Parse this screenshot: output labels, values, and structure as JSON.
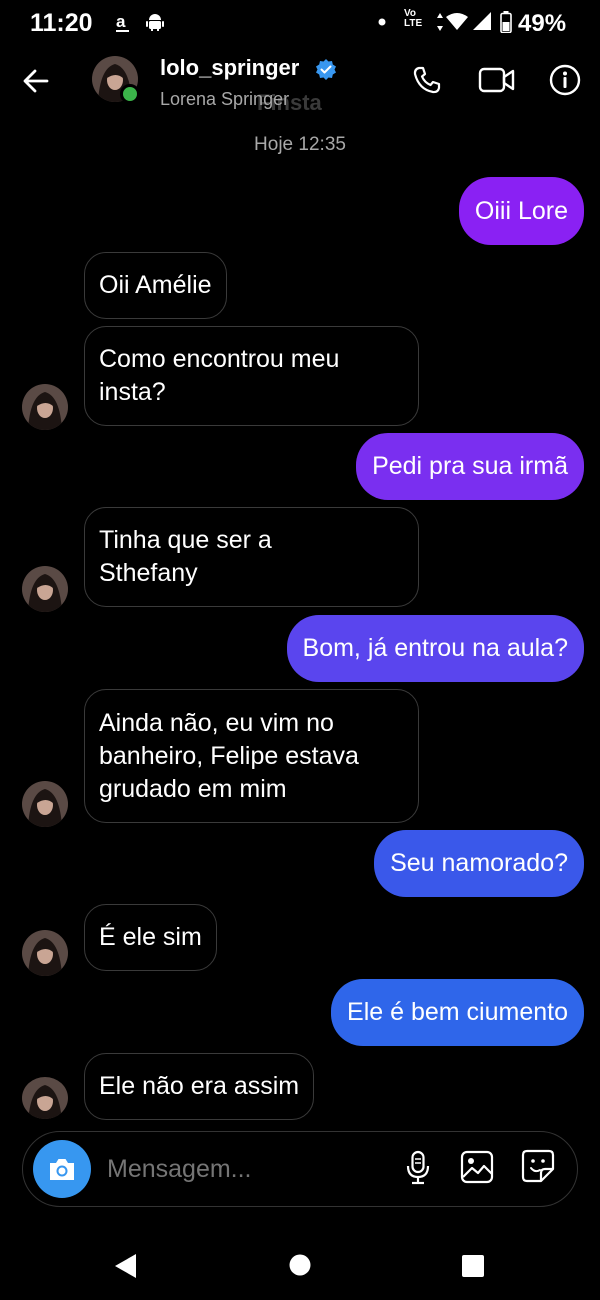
{
  "status_bar": {
    "time": "11:20",
    "lte_top": "Vo",
    "lte_bottom": "LTE",
    "battery": "49%"
  },
  "header": {
    "username": "lolo_springer",
    "full_name": "Lorena Springer",
    "ghost_text": "Finsta",
    "icons": [
      "back-arrow-icon",
      "verified-icon",
      "phone-icon",
      "video-camera-icon",
      "info-icon"
    ]
  },
  "timestamp": "Hoje 12:35",
  "messages": [
    {
      "dir": "out",
      "lines": [
        "Oiii Lore"
      ],
      "color": "#8a21f3"
    },
    {
      "dir": "in",
      "lines": [
        "Oii Amélie"
      ]
    },
    {
      "dir": "in",
      "lines": [
        "Como encontrou meu",
        "insta?"
      ]
    },
    {
      "dir": "out",
      "lines": [
        "Pedi pra sua irmã"
      ],
      "color": "#7a2ff0"
    },
    {
      "dir": "in",
      "lines": [
        "Tinha que ser a",
        "Sthefany"
      ]
    },
    {
      "dir": "out",
      "lines": [
        "Bom, já entrou na aula?"
      ],
      "color": "#5a45ee"
    },
    {
      "dir": "in",
      "lines": [
        "Ainda não, eu vim no",
        "banheiro, Felipe estava",
        "grudado em mim"
      ]
    },
    {
      "dir": "out",
      "lines": [
        "Seu namorado?"
      ],
      "color": "#3a58ea"
    },
    {
      "dir": "in",
      "lines": [
        "É ele sim"
      ]
    },
    {
      "dir": "out",
      "lines": [
        "Ele é bem ciumento"
      ],
      "color": "#2f66ea"
    },
    {
      "dir": "in",
      "lines": [
        "Ele não era assim"
      ]
    }
  ],
  "composer": {
    "placeholder": "Mensagem...",
    "icons": [
      "camera-icon",
      "microphone-icon",
      "gallery-icon",
      "sticker-icon"
    ]
  },
  "colors": {
    "background": "#000000",
    "camera_button": "#3797f0",
    "verified": "#3897f0",
    "online": "#3bb54a"
  }
}
